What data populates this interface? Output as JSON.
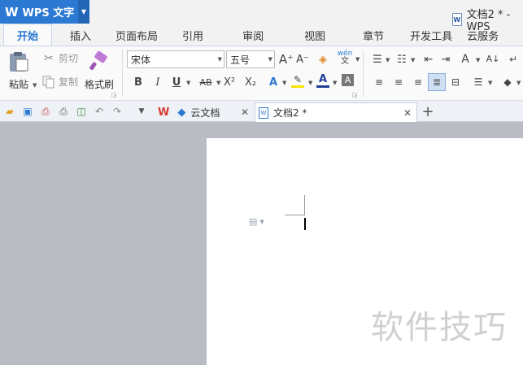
{
  "app": {
    "name": "WPS 文字",
    "logo": "W"
  },
  "window": {
    "title": "文档2 * - WPS"
  },
  "ribbon_tabs": [
    {
      "label": "开始",
      "active": true
    },
    {
      "label": "插入"
    },
    {
      "label": "页面布局"
    },
    {
      "label": "引用"
    },
    {
      "label": "审阅"
    },
    {
      "label": "视图"
    },
    {
      "label": "章节"
    },
    {
      "label": "开发工具"
    },
    {
      "label": "云服务"
    }
  ],
  "clipboard": {
    "paste_label": "粘贴",
    "cut_label": "剪切",
    "copy_label": "复制",
    "format_painter_label": "格式刷"
  },
  "font": {
    "family_value": "宋体",
    "size_value": "五号",
    "phonetic_label": "wén"
  },
  "format_buttons": {
    "bold": "B",
    "italic": "I",
    "underline": "U",
    "strikethrough": "AB",
    "superscript": "X²",
    "subscript": "X₂",
    "text_effect": "A",
    "font_color": "A",
    "char_shading": "A",
    "grow": "A⁺",
    "shrink": "A⁻"
  },
  "doc_tabs": [
    {
      "label": "云文档",
      "active": false
    },
    {
      "label": "文档2 *",
      "active": true
    }
  ],
  "watermark": "软件技巧",
  "colors": {
    "accent": "#2b79d3",
    "workspace_bg": "#b9bcc3",
    "highlight_yellow": "#f5e600",
    "font_color_red": "#d22b2b"
  }
}
